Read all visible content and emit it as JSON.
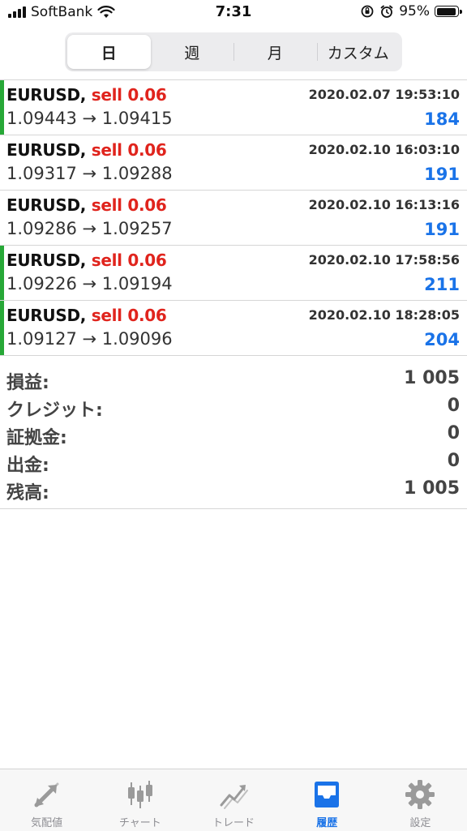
{
  "status_bar": {
    "carrier": "SoftBank",
    "time": "7:31",
    "battery": "95%",
    "battery_level": 0.95
  },
  "period_tabs": [
    {
      "label": "日",
      "active": true
    },
    {
      "label": "週",
      "active": false
    },
    {
      "label": "月",
      "active": false
    },
    {
      "label": "カスタム",
      "active": false
    }
  ],
  "deals": [
    {
      "symbol": "EURUSD,",
      "side": "sell 0.06",
      "time": "2020.02.07 19:53:10",
      "prices": "1.09443 → 1.09415",
      "profit": "184"
    },
    {
      "symbol": "EURUSD,",
      "side": "sell 0.06",
      "time": "2020.02.10 16:03:10",
      "prices": "1.09317 → 1.09288",
      "profit": "191"
    },
    {
      "symbol": "EURUSD,",
      "side": "sell 0.06",
      "time": "2020.02.10 16:13:16",
      "prices": "1.09286 → 1.09257",
      "profit": "191"
    },
    {
      "symbol": "EURUSD,",
      "side": "sell 0.06",
      "time": "2020.02.10 17:58:56",
      "prices": "1.09226 → 1.09194",
      "profit": "211"
    },
    {
      "symbol": "EURUSD,",
      "side": "sell 0.06",
      "time": "2020.02.10 18:28:05",
      "prices": "1.09127 → 1.09096",
      "profit": "204"
    }
  ],
  "summary": [
    {
      "label": "損益:",
      "value": "1 005"
    },
    {
      "label": "クレジット:",
      "value": "0"
    },
    {
      "label": "証拠金:",
      "value": "0"
    },
    {
      "label": "出金:",
      "value": "0"
    },
    {
      "label": "残高:",
      "value": "1 005"
    }
  ],
  "tab_bar": [
    {
      "label": "気配値",
      "icon": "quotes-arrows-icon",
      "active": false
    },
    {
      "label": "チャート",
      "icon": "candlestick-icon",
      "active": false
    },
    {
      "label": "トレード",
      "icon": "trade-trend-icon",
      "active": false
    },
    {
      "label": "履歴",
      "icon": "history-inbox-icon",
      "active": true
    },
    {
      "label": "設定",
      "icon": "gear-icon",
      "active": false
    }
  ],
  "colors": {
    "buy_stripe": "#27a837",
    "sell_text": "#e0241d",
    "profit_blue": "#1a73e8",
    "tab_inactive": "#8e8e93"
  }
}
